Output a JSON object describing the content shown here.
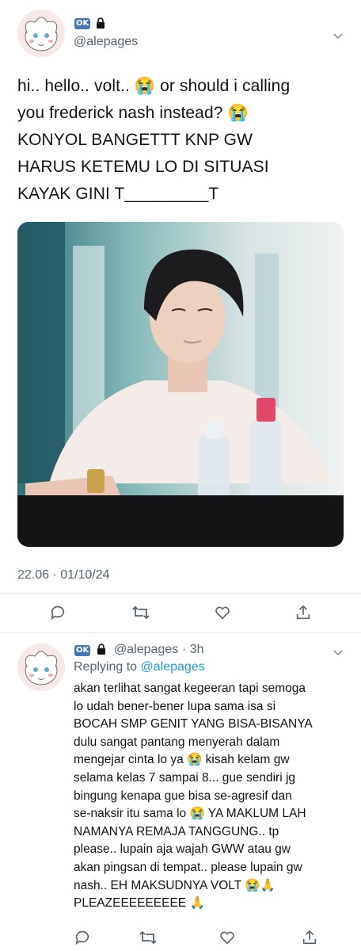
{
  "tweet": {
    "badge": "OK",
    "username": "@alepages",
    "text_lines": [
      "hi.. hello.. volt.. 😭 or should i calling",
      "you frederick nash instead? 😭",
      "KONYOL BANGETTT KNP GW",
      "HARUS KETEMU LO DI SITUASI",
      "KAYAK GINI T_________T"
    ],
    "timestamp": "22.06 · 01/10/24"
  },
  "reply": {
    "badge": "OK",
    "username": "@alepages",
    "time": "· 3h",
    "replying_prefix": "Replying to",
    "replying_to": "@alepages",
    "text_lines": [
      "akan terlihat sangat kegeeran tapi semoga",
      "lo udah bener-bener lupa sama isa si",
      "BOCAH SMP GENIT YANG BISA-BISANYA",
      "dulu sangat pantang menyerah dalam",
      "mengejar cinta lo ya 😭 kisah kelam gw",
      "selama kelas 7 sampai 8... gue sendiri jg",
      "bingung kenapa gue bisa se-agresif dan",
      "se-naksir itu sama lo 😭 YA MAKLUM LAH",
      "NAMANYA REMAJA TANGGUNG.. tp",
      "please.. lupain aja wajah GWW atau gw",
      "akan pingsan di tempat.. please lupain gw",
      "nash.. EH MAKSUDNYA VOLT 😭🙏",
      "PLEAZEEEEEEEEE 🙏"
    ]
  },
  "icons": [
    "lock-icon",
    "chevron-down-icon",
    "reply-icon",
    "retweet-icon",
    "like-icon",
    "share-icon"
  ],
  "colors": {
    "accent": "#1d9bf0",
    "secondary_text": "#536471",
    "divider": "#e6e9ec"
  }
}
